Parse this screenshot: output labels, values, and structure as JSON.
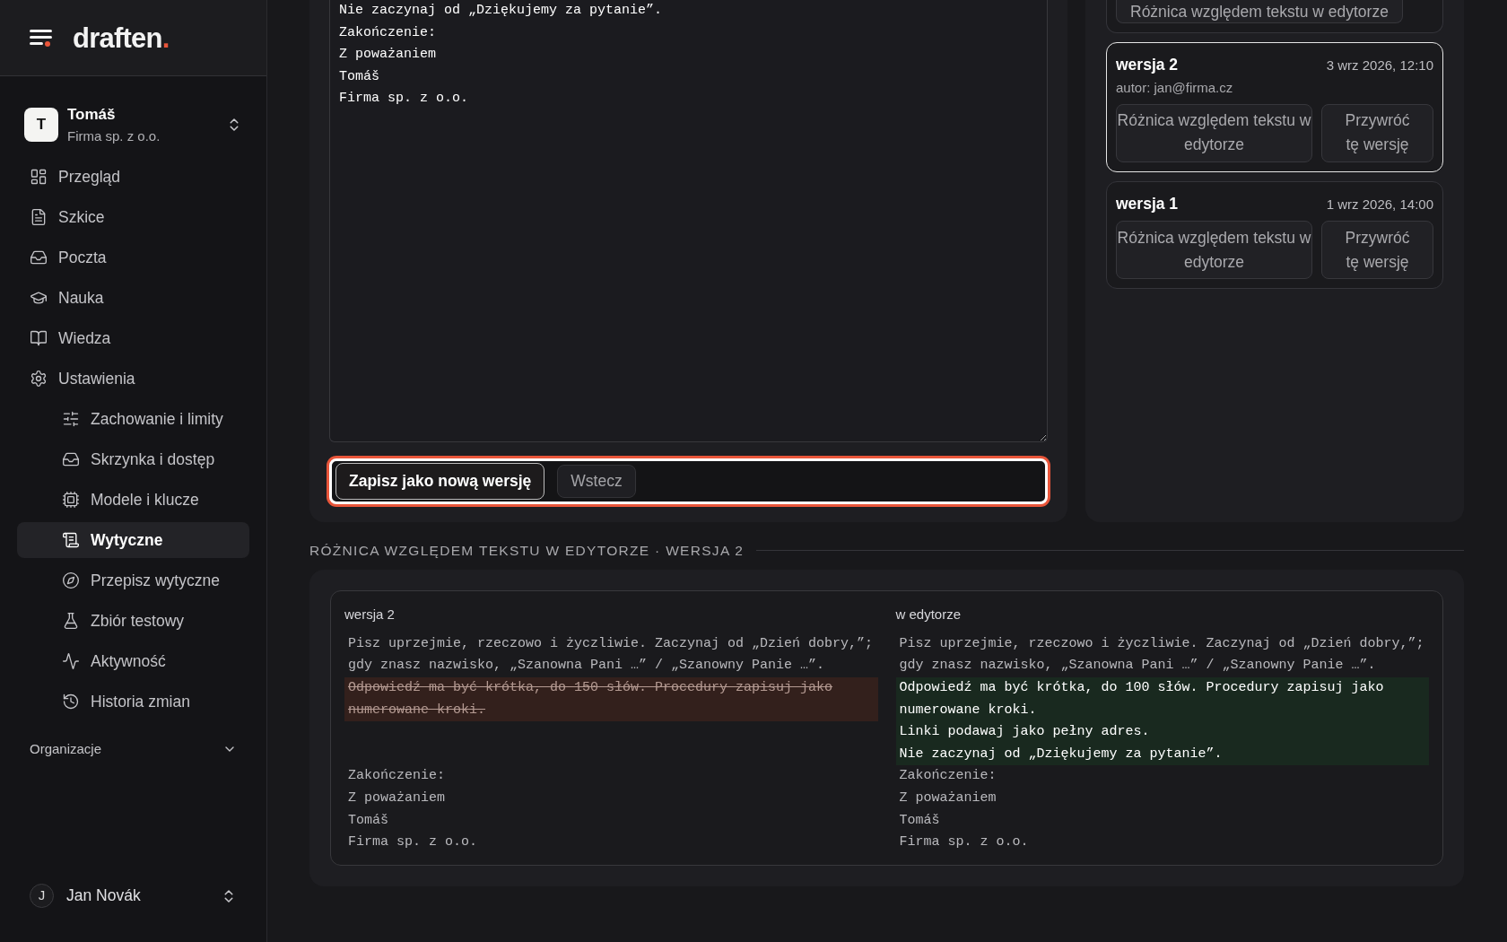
{
  "logo": {
    "name": "draften",
    "dot": "."
  },
  "workspace": {
    "initial": "T",
    "name": "Tomáš",
    "company": "Firma sp. z o.o."
  },
  "nav": [
    {
      "label": "Przegląd",
      "selected": false
    },
    {
      "label": "Szkice",
      "selected": false
    },
    {
      "label": "Poczta",
      "selected": false
    },
    {
      "label": "Nauka",
      "selected": false
    },
    {
      "label": "Wiedza",
      "selected": false
    },
    {
      "label": "Ustawienia",
      "selected": false,
      "children": [
        {
          "label": "Zachowanie i limity",
          "selected": false
        },
        {
          "label": "Skrzynka i dostęp",
          "selected": false
        },
        {
          "label": "Modele i klucze",
          "selected": false
        },
        {
          "label": "Wytyczne",
          "selected": true
        },
        {
          "label": "Przepisz wytyczne",
          "selected": false
        },
        {
          "label": "Zbiór testowy",
          "selected": false
        },
        {
          "label": "Aktywność",
          "selected": false
        },
        {
          "label": "Historia zmian",
          "selected": false
        }
      ]
    }
  ],
  "organizations": {
    "label": "Organizacje",
    "expanded": false
  },
  "user": {
    "initial": "J",
    "name": "Jan Novák"
  },
  "editor": {
    "lines": [
      "Nie zaczynaj od „Dziękujemy za pytanie”.",
      "Zakończenie:",
      "Z poważaniem",
      "Tomáš",
      "Firma sp. z o.o."
    ],
    "toolbar": {
      "highlighted": true,
      "buttons": [
        {
          "label": "Zapisz jako nową wersję",
          "kind": "primary"
        },
        {
          "label": "Wstecz",
          "kind": "secondary"
        }
      ]
    }
  },
  "versions": [
    {
      "kind": "partial",
      "selected": false,
      "diff_button": "Różnica względem tekstu w edytorze"
    },
    {
      "kind": "full",
      "selected": true,
      "title": "wersja 2",
      "date": "3 wrz 2026, 12:10",
      "author": "autor: jan@firma.cz",
      "diff_button": "Różnica względem tekstu w edytorze",
      "restore_button": "Przywróć tę wersję"
    },
    {
      "kind": "full",
      "selected": false,
      "title": "wersja 1",
      "date": "1 wrz 2026, 14:00",
      "diff_button": "Różnica względem tekstu w edytorze",
      "restore_button": "Przywróć tę wersję"
    }
  ],
  "diff": {
    "heading": "RÓŻNICA WZGLĘDEM TEKSTU W EDYTORZE · WERSJA 2",
    "left_title": "wersja 2",
    "right_title": "w edytorze",
    "rows": [
      {
        "kind": "same",
        "left": [
          "Pisz uprzejmie, rzeczowo i życzliwie. Zaczynaj od „Dzień dobry,”; gdy znasz nazwisko, „Szanowna Pani …” / „Szanowny Panie …”."
        ],
        "right": [
          "Pisz uprzejmie, rzeczowo i życzliwie. Zaczynaj od „Dzień dobry,”; gdy znasz nazwisko, „Szanowna Pani …” / „Szanowny Panie …”."
        ]
      },
      {
        "kind": "changed",
        "left": [
          "Odpowiedź ma być krótka, do 150 słów. Procedury zapisuj jako numerowane kroki."
        ],
        "right": [
          "Odpowiedź ma być krótka, do 100 słów. Procedury zapisuj jako numerowane kroki.",
          "Linki podawaj jako pełny adres.",
          "Nie zaczynaj od „Dziękujemy za pytanie”."
        ]
      },
      {
        "kind": "same",
        "left": [
          "Zakończenie:"
        ],
        "right": [
          "Zakończenie:"
        ]
      },
      {
        "kind": "same",
        "left": [
          "Z poważaniem"
        ],
        "right": [
          "Z poważaniem"
        ]
      },
      {
        "kind": "same",
        "left": [
          "Tomáš"
        ],
        "right": [
          "Tomáš"
        ]
      },
      {
        "kind": "same",
        "left": [
          "Firma sp. z o.o."
        ],
        "right": [
          "Firma sp. z o.o."
        ]
      }
    ]
  }
}
